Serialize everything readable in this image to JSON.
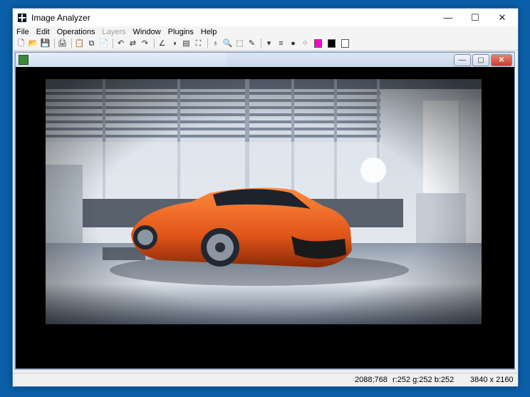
{
  "window": {
    "title": "Image Analyzer",
    "minimize_glyph": "—",
    "maximize_glyph": "☐",
    "close_glyph": "✕"
  },
  "menu": [
    "File",
    "Edit",
    "Operations",
    "Layers",
    "Window",
    "Plugins",
    "Help"
  ],
  "toolbar": {
    "icons": [
      "new-file-icon",
      "open-folder-icon",
      "save-icon",
      "print-icon",
      "paste-icon",
      "copy-icon",
      "clipboard-icon",
      "undo-icon",
      "swap-icon",
      "redo-icon",
      "curve-icon",
      "contrast-icon",
      "layers-icon",
      "fit-icon",
      "pin-icon",
      "zoom-icon",
      "select-icon",
      "pen-icon",
      "dropdown-arrow-icon",
      "line-width-icon",
      "brush-icon",
      "dots-icon"
    ],
    "glyphs": [
      "🗋",
      "📂",
      "💾",
      "🖨",
      "📋",
      "⧉",
      "📄",
      "↶",
      "⇄",
      "↷",
      "∠",
      "◑",
      "▤",
      "⛶",
      "♁",
      "🔍",
      "⬚",
      "✎",
      "▾",
      "≡",
      "●",
      "⁘"
    ],
    "colors": {
      "primary": "#ff00cc",
      "secondary": "#000000",
      "background": "#ffffff"
    }
  },
  "image_window": {
    "min_glyph": "—",
    "max_glyph": "▢",
    "close_glyph": "✕"
  },
  "status": {
    "coords": "2088;768",
    "rgb": "r:252 g:252 b:252",
    "size": "3840 x 2160"
  }
}
